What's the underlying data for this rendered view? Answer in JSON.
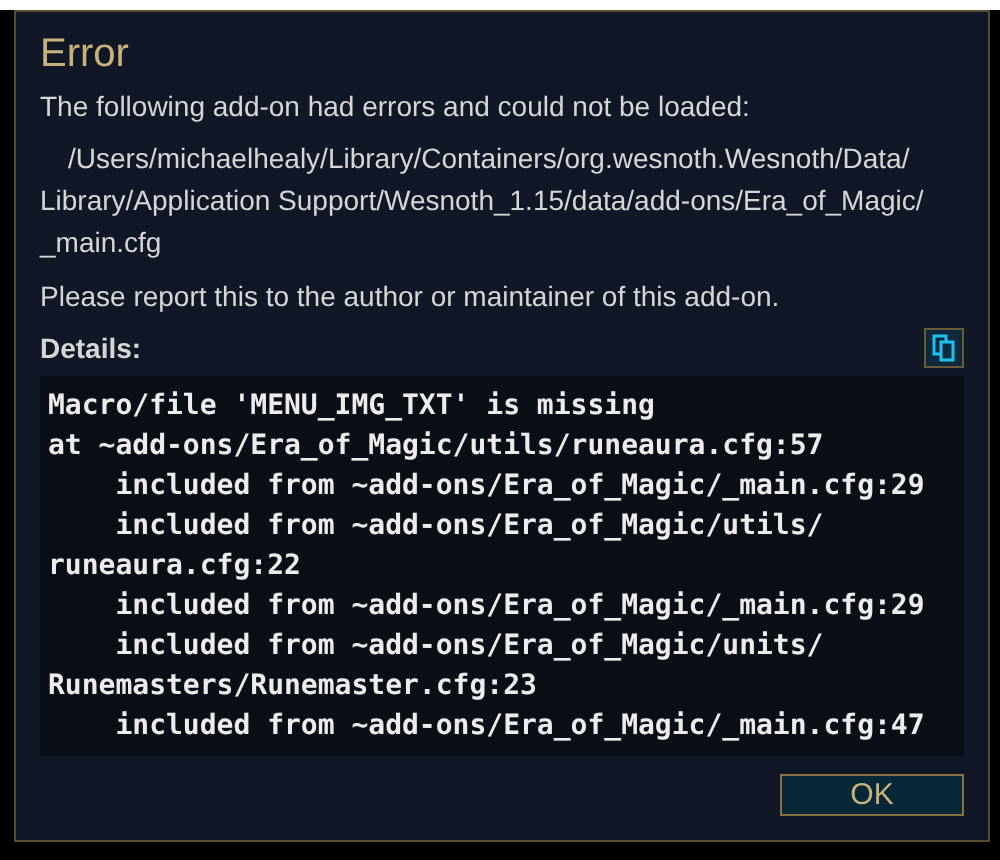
{
  "dialog": {
    "title": "Error",
    "message": "The following add-on had errors and could not be loaded:",
    "path_lines": [
      "/Users/michaelhealy/Library/Containers/org.wesnoth.Wesnoth/Data/",
      "Library/Application Support/Wesnoth_1.15/data/add-ons/Era_of_Magic/",
      "_main.cfg"
    ],
    "report": "Please report this to the author or maintainer of this add-on.",
    "details_label": "Details:",
    "log_lines": [
      "Macro/file 'MENU_IMG_TXT' is missing",
      "at ~add-ons/Era_of_Magic/utils/runeaura.cfg:57",
      "    included from ~add-ons/Era_of_Magic/_main.cfg:29",
      "    included from ~add-ons/Era_of_Magic/utils/",
      "runeaura.cfg:22",
      "    included from ~add-ons/Era_of_Magic/_main.cfg:29",
      "    included from ~add-ons/Era_of_Magic/units/",
      "Runemasters/Runemaster.cfg:23",
      "    included from ~add-ons/Era_of_Magic/_main.cfg:47"
    ],
    "buttons": [
      "OK"
    ]
  }
}
